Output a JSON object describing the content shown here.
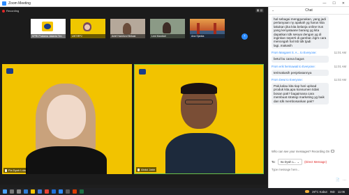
{
  "window": {
    "title": "Zoom Meeting",
    "minimize": "—",
    "maximize": "☐",
    "close": "✕"
  },
  "recording": {
    "label": "Recording"
  },
  "gallery": {
    "thumbnails": [
      {
        "label": "KPRI Pratama Jakarta Tim"
      },
      {
        "label": "UKT.RPJ"
      },
      {
        "label": "Arief Hamrizul Bekasi"
      },
      {
        "label": "Leni Mardiati"
      },
      {
        "label": "Ana Sjarkia"
      }
    ],
    "next_icon": "chevron-right-icon"
  },
  "main_tiles": [
    {
      "name": "Fia Dyah Lola"
    },
    {
      "name": "Abdul Jabir"
    }
  ],
  "chat": {
    "title": "Chat",
    "messages": [
      {
        "text": "hal sebagai menggunakan, yang jadi pertanyaan ny apakah yg harus kita lakukan jika kita belanja online trus yang kenyataane barang yg kita dapatkan tdk sesuai dengan yg di inginkan seperti di gambar..bgm cara mencegah hal tsb tdk tjadi lagi..makasih"
      },
      {
        "from": "From Margaret S. A...",
        "to": "to Everyone:",
        "time": "11:01 AM",
        "text": "betul bu canva bagus"
      },
      {
        "from": "From erik hermawati",
        "to": "to Everyone:",
        "time": "11:01 AM",
        "text": "terimakasih penjelasannya"
      },
      {
        "from": "From Dewi",
        "to": "to Everyone:",
        "time": "11:02 AM",
        "text": "Pak,kalau kita tiap hari upload produk kita,apa konsumen tidak bosan pak? bagaimana cara membuat strategi marketing yg baik dan tdk membosankan pak?"
      }
    ],
    "who_can_see": "Who can see your messages? Recording On",
    "to_label": "To:",
    "to_value": "Ira Dyah L...",
    "direct_message": "(Direct Message)",
    "input_placeholder": "Type message here..."
  },
  "taskbar": {
    "temperature": "29°C  Kabut",
    "time": "11:06",
    "lang": "IND"
  }
}
